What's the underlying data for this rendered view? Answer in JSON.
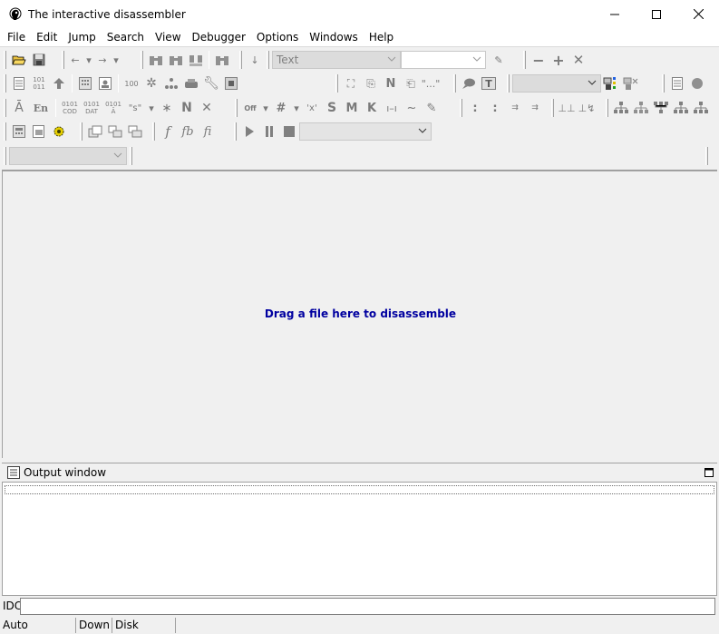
{
  "window": {
    "title": "The interactive disassembler"
  },
  "menu": {
    "items": [
      "File",
      "Edit",
      "Jump",
      "Search",
      "View",
      "Debugger",
      "Options",
      "Windows",
      "Help"
    ]
  },
  "toolbar": {
    "segment_combo": "Text"
  },
  "main": {
    "drag_hint": "Drag a file here to disassemble"
  },
  "output": {
    "title": "Output window"
  },
  "idc": {
    "label": "IDC",
    "value": ""
  },
  "status": {
    "mode": "Auto",
    "direction": "Down",
    "disk": "Disk"
  },
  "colors": {
    "hint_text": "#0000a0",
    "background": "#f0f0f0"
  }
}
